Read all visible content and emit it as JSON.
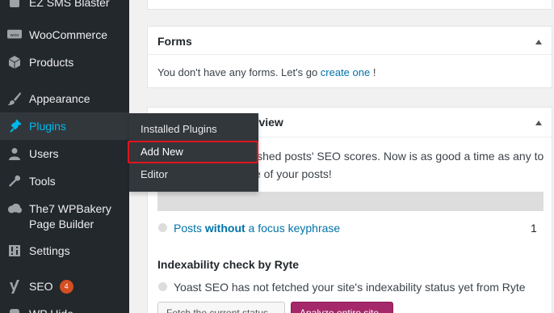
{
  "sidebar": {
    "items": [
      {
        "label": "EZ SMS Blaster",
        "icon": "plugin-icon"
      },
      {
        "label": "WooCommerce",
        "icon": "woocommerce-icon",
        "icon_text": "woo"
      },
      {
        "label": "Products",
        "icon": "products-icon"
      },
      {
        "label": "Appearance",
        "icon": "brush-icon"
      },
      {
        "label": "Plugins",
        "icon": "plugins-icon"
      },
      {
        "label": "Users",
        "icon": "users-icon"
      },
      {
        "label": "Tools",
        "icon": "wrench-icon"
      },
      {
        "label": "The7 WPBakery",
        "label2": "Page Builder",
        "icon": "cloud-icon"
      },
      {
        "label": "Settings",
        "icon": "settings-icon"
      },
      {
        "label": "SEO",
        "icon": "yoast-icon",
        "badge": "4"
      },
      {
        "label": "WP Hide",
        "icon": "hide-icon"
      }
    ]
  },
  "flyout": {
    "items": [
      "Installed Plugins",
      "Add New",
      "Editor"
    ]
  },
  "forms_panel": {
    "title": "Forms",
    "text_before": "You don't have any forms. Let's go ",
    "link": "create one",
    "text_after": " !"
  },
  "seo_panel": {
    "title_partial": "rview",
    "line1": "ished posts' SEO scores. Now is as good a time as any to",
    "line2": "e of your posts!",
    "row_label_pre": "Posts ",
    "row_label_bold": "without",
    "row_label_post": " a focus keyphrase",
    "row_count": "1",
    "indexability_title": "Indexability check by Ryte",
    "indexability_text": "Yoast SEO has not fetched your site's indexability status yet from Ryte",
    "btn_fetch": "Fetch the current status",
    "btn_analyze": "Analyze entire site"
  },
  "colors": {
    "sidebar_bg": "#23282d",
    "active_text": "#00b9eb",
    "highlight_border": "#e0151c",
    "badge": "#d54e21",
    "primary_btn": "#a4286a",
    "link": "#0073aa"
  }
}
